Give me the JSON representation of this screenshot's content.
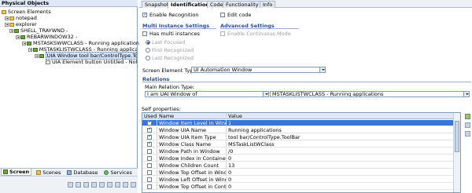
{
  "left_panel": {
    "title": "Physical Objects",
    "tree": [
      {
        "label": "Screen Elements",
        "icon": "folder-icon"
      },
      {
        "label": "notepad",
        "icon": "folder-icon"
      },
      {
        "label": "explorer",
        "icon": "folder-icon"
      },
      {
        "label": "SHELL_TRAYWND -",
        "icon": "window-icon"
      },
      {
        "label": "REBARWINDOW32 -",
        "icon": "window-icon"
      },
      {
        "label": "MSTASKSWWCLASS - Running applications",
        "icon": "window-icon"
      },
      {
        "label": "MSTASKLISTWCLASS - Running applicati",
        "icon": "window-icon"
      },
      {
        "label": "UIA Window tool bar/ControlType.Too",
        "icon": "window-icon"
      },
      {
        "label": "UIA Element button Untitled - Not",
        "icon": "window-icon"
      }
    ],
    "bottom_tabs": [
      "Screen",
      "Scenes",
      "Database",
      "Services"
    ]
  },
  "tabs": [
    "Snapshot",
    "Identification",
    "Code",
    "Functionality",
    "Info"
  ],
  "active_tab": "Identification",
  "identification": {
    "enable_recognition": "Enable Recognition",
    "edit_code": "Edit code",
    "multi_instance_title": "Multi Instance Settings",
    "has_multi_instances": "Has multi instances",
    "radios": [
      "Last Focused",
      "First Recognized",
      "Last Recognized"
    ],
    "advanced_title": "Advanced Settings",
    "enable_continuous": "Enable Continuous Mode",
    "screen_element_type_label": "Screen Element Type:",
    "screen_element_type_value": "UI Automation Window",
    "relations_title": "Relations",
    "main_relation_label": "Main Relation Type:",
    "main_relation_value": "I am UAI Window of",
    "relation_target_value": "MSTASKLISTWCLASS - Running applications",
    "self_properties_label": "Self properties:"
  },
  "table": {
    "headers": [
      "Used",
      "Name",
      "Value"
    ],
    "rows": [
      {
        "used": true,
        "name": "Window Item Level in Window",
        "value": "1",
        "selected": true
      },
      {
        "used": true,
        "name": "Window UIA Name",
        "value": "Running applications"
      },
      {
        "used": true,
        "name": "Window UIA Item Type",
        "value": "tool bar/ControlType.ToolBar"
      },
      {
        "used": true,
        "name": "Window Class Name",
        "value": "MSTaskListWClass"
      },
      {
        "used": false,
        "name": "Window Path in Window",
        "value": "/0"
      },
      {
        "used": false,
        "name": "Window Index in Container",
        "value": "0"
      },
      {
        "used": false,
        "name": "Window Children Count",
        "value": "13"
      },
      {
        "used": false,
        "name": "Window Top Offset in Window",
        "value": "0"
      },
      {
        "used": false,
        "name": "Window Left Offset in Window",
        "value": "0"
      },
      {
        "used": false,
        "name": "Window Top Offset in Containe...",
        "value": "0"
      }
    ]
  }
}
